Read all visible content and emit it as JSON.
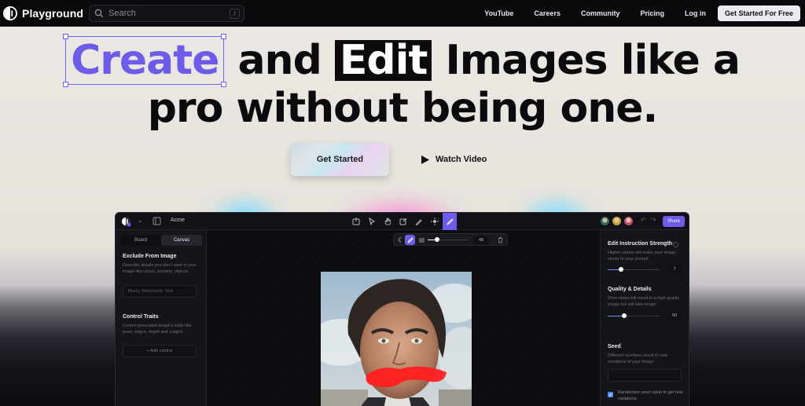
{
  "nav": {
    "brand": "Playground",
    "search_placeholder": "Search",
    "search_shortcut": "/",
    "links": [
      "YouTube",
      "Careers",
      "Community",
      "Pricing",
      "Log in"
    ],
    "cta": "Get Started For Free"
  },
  "hero": {
    "word_create": "Create",
    "text_and": " and ",
    "word_edit": "Edit",
    "text_rest1": " Images like a",
    "line2": "pro without being one.",
    "primary_button": "Get Started",
    "secondary_button": "Watch Video",
    "accent_color": "#6c5ce7"
  },
  "editor": {
    "project_name": "Acme",
    "share_label": "Share",
    "tabs": [
      "Board",
      "Canvas"
    ],
    "active_tab": "Canvas",
    "brush_size": "48",
    "left_panel": {
      "exclude_title": "Exclude From Image",
      "exclude_desc": "Describe details you don't want in your image like colors, scenery, objects",
      "exclude_placeholder": "Blurry, Watermark, Text",
      "traits_title": "Control Traits",
      "traits_desc": "Control generated image's traits like pose, edges, depth and subject",
      "add_control": "+ Add control"
    },
    "right_panel": {
      "strength_title": "Edit Instruction Strength",
      "strength_desc": "Higher values will make your image closer to your prompt",
      "strength_value": "7",
      "quality_title": "Quality & Details",
      "quality_desc": "More steps will result in a high quality image but will take longer.",
      "quality_value": "50",
      "seed_title": "Seed",
      "seed_desc": "Different numbers result in new variations of your image.",
      "randomize_label": "Randomize seed value to get new variations"
    }
  }
}
